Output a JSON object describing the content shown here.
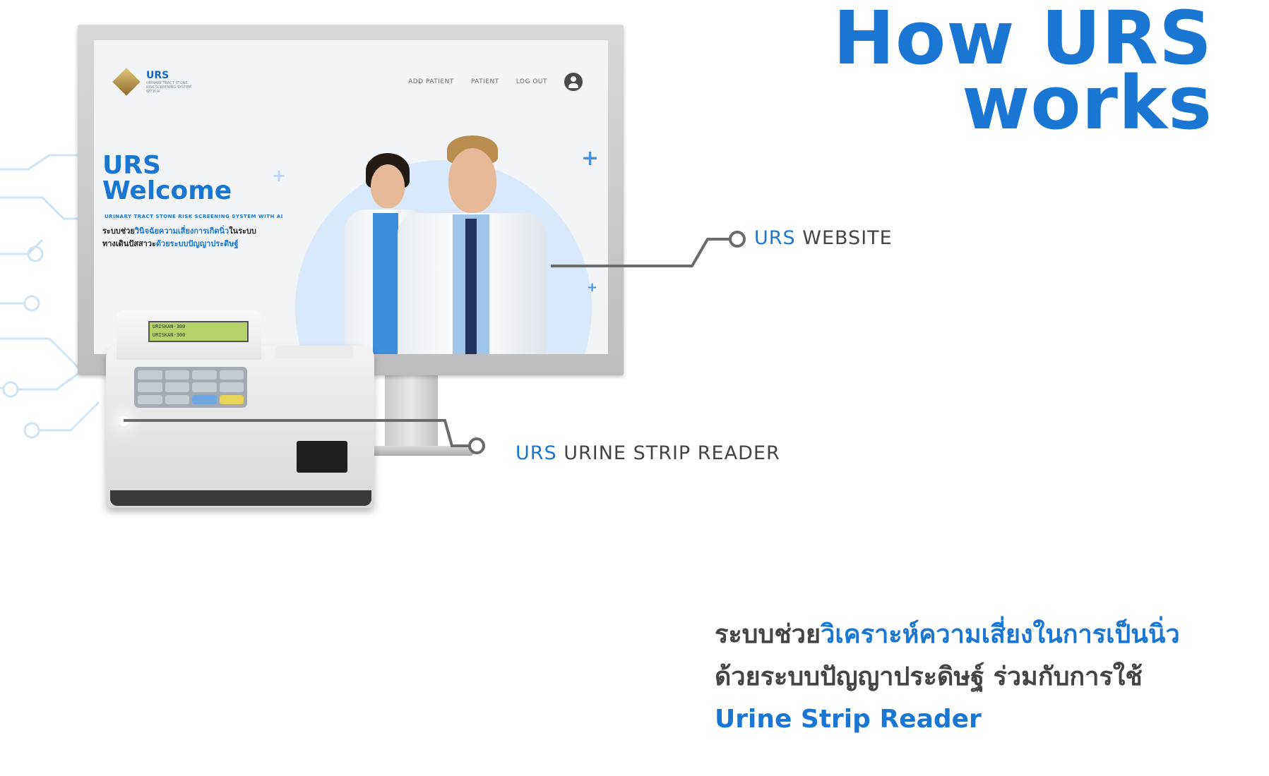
{
  "headline": {
    "line1": "How URS",
    "line2": "works"
  },
  "website_mock": {
    "logo_name": "URS",
    "logo_tagline": "URINARY TRACT STONE RISK SCREENING SYSTEM WITH AI",
    "nav": [
      "ADD PATIENT",
      "PATIENT",
      "LOG OUT"
    ],
    "welcome_line1": "URS",
    "welcome_line2": "Welcome",
    "subtitle": "URINARY TRACT STONE RISK SCREENING SYSTEM WITH AI",
    "desc_part1": "ระบบช่วย",
    "desc_part2_blue": "วินิจฉัยความเสี่ยงการเกิดนิ่ว",
    "desc_part3": "ในระบบ",
    "desc_part4": "ทางเดินปัสสาวะ",
    "desc_part5_blue": "ด้วยระบบปัญญาประดิษฐ์"
  },
  "device": {
    "screen_line1": "URISKAN-300",
    "screen_line2": "URISKAN-300"
  },
  "callouts": {
    "website": {
      "accent": "URS",
      "text": " WEBSITE"
    },
    "reader": {
      "accent": "URS",
      "text": " URINE STRIP READER"
    }
  },
  "tagline": {
    "line1_part1": "ระบบช่วย",
    "line1_part2_blue": "วิเคราะห์ความเสี่ยงในการเป็นนิ่ว",
    "line2": "ด้วยระบบปัญญาประดิษฐ์ ร่วมกับการใช้",
    "line3_blue": "Urine Strip Reader"
  },
  "colors": {
    "accent": "#1976d2",
    "text": "#444444"
  }
}
